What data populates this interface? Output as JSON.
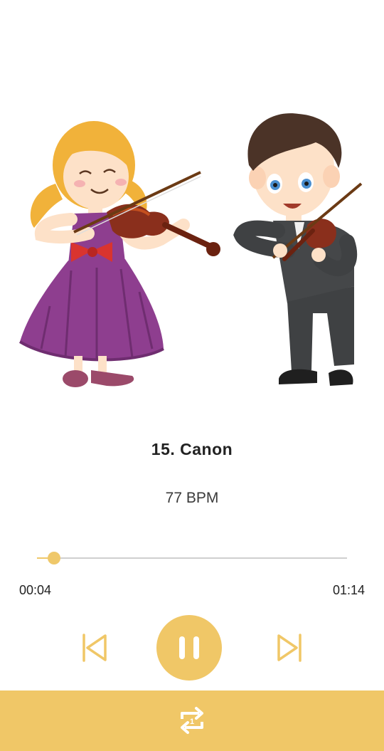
{
  "player": {
    "track_title": "15. Canon",
    "tempo": "77 BPM",
    "elapsed": "00:04",
    "total": "01:14",
    "progress": 0.054,
    "state": "playing"
  },
  "controls": {
    "previous_icon": "skip-previous-icon",
    "pause_icon": "pause-icon",
    "next_icon": "skip-next-icon",
    "repeat_icon": "repeat-one-icon",
    "repeat_badge": "1"
  },
  "colors": {
    "accent": "#f0c767",
    "track": "#cfcfcf",
    "text": "#222222"
  }
}
